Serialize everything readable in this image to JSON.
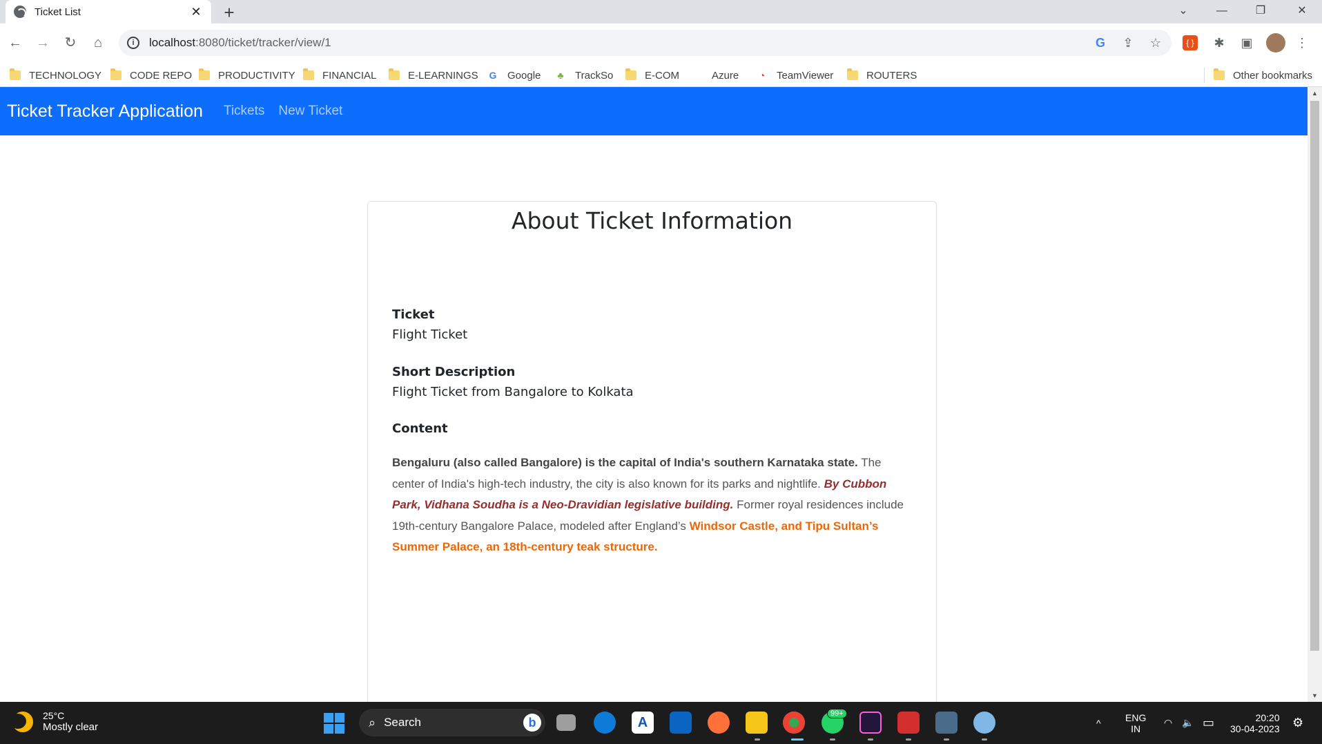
{
  "browser": {
    "tab_title": "Ticket List",
    "tab_close": "✕",
    "new_tab": "+",
    "url_host": "localhost",
    "url_rest": ":8080/ticket/tracker/view/1",
    "window_controls": {
      "dropdown": "⌄",
      "minimize": "—",
      "restore": "❐",
      "close": "✕"
    },
    "nav": {
      "back": "←",
      "forward": "→",
      "reload": "↻",
      "home": "⌂"
    },
    "omni_icons": [
      "G",
      "⇪",
      "☆"
    ],
    "toolbar_icons": [
      "{ }",
      "✱",
      "▣",
      "⋮"
    ]
  },
  "bookmarks": [
    {
      "label": "TECHNOLOGY",
      "icon": "folder-icon"
    },
    {
      "label": "CODE REPO",
      "icon": "folder-icon"
    },
    {
      "label": "PRODUCTIVITY",
      "icon": "folder-icon"
    },
    {
      "label": "FINANCIAL",
      "icon": "folder-icon"
    },
    {
      "label": "E-LEARNINGS",
      "icon": "folder-icon"
    },
    {
      "label": "Google",
      "icon": "google-icon"
    },
    {
      "label": "TrackSo",
      "icon": "trackso-icon"
    },
    {
      "label": "E-COM",
      "icon": "folder-icon"
    },
    {
      "label": "Azure",
      "icon": "microsoft-icon"
    },
    {
      "label": "TeamViewer",
      "icon": "teamviewer-icon"
    },
    {
      "label": "ROUTERS",
      "icon": "folder-icon"
    }
  ],
  "other_bookmarks": "Other bookmarks",
  "app": {
    "brand": "Ticket Tracker Application",
    "nav_tickets": "Tickets",
    "nav_new_ticket": "New Ticket"
  },
  "ticket": {
    "heading": "About Ticket Information",
    "ticket_label": "Ticket",
    "ticket_value": "Flight Ticket",
    "short_desc_label": "Short Description",
    "short_desc_value": "Flight Ticket from Bangalore to Kolkata",
    "content_label": "Content",
    "content_part1": "Bengaluru (also called Bangalore) is the capital of India's southern Karnataka state.",
    "content_part2": " The center of India's high-tech industry, the city is also known for its parks and nightlife. ",
    "content_part3": "By Cubbon Park, Vidhana Soudha is a Neo-Dravidian legislative building.",
    "content_part4": " Former royal residences include 19th-century Bangalore Palace, modeled after England’s ",
    "content_part5": "Windsor Castle, and Tipu Sultan’s Summer Palace, an 18th-century teak structure."
  },
  "taskbar": {
    "temperature": "25°C",
    "weather": "Mostly clear",
    "search_label": "Search",
    "search_icon": "⌕",
    "bing": "b",
    "whatsapp_badge": "99+",
    "lang1": "ENG",
    "lang2": "IN",
    "time": "20:20",
    "date": "30-04-2023",
    "chevron": "^",
    "wifi": "◠",
    "volume": "🔈",
    "battery": "▭",
    "settings": "⚙"
  },
  "colors": {
    "navbar": "#0d6efd",
    "content_red": "#962e2e",
    "content_orange": "#e9680c"
  }
}
